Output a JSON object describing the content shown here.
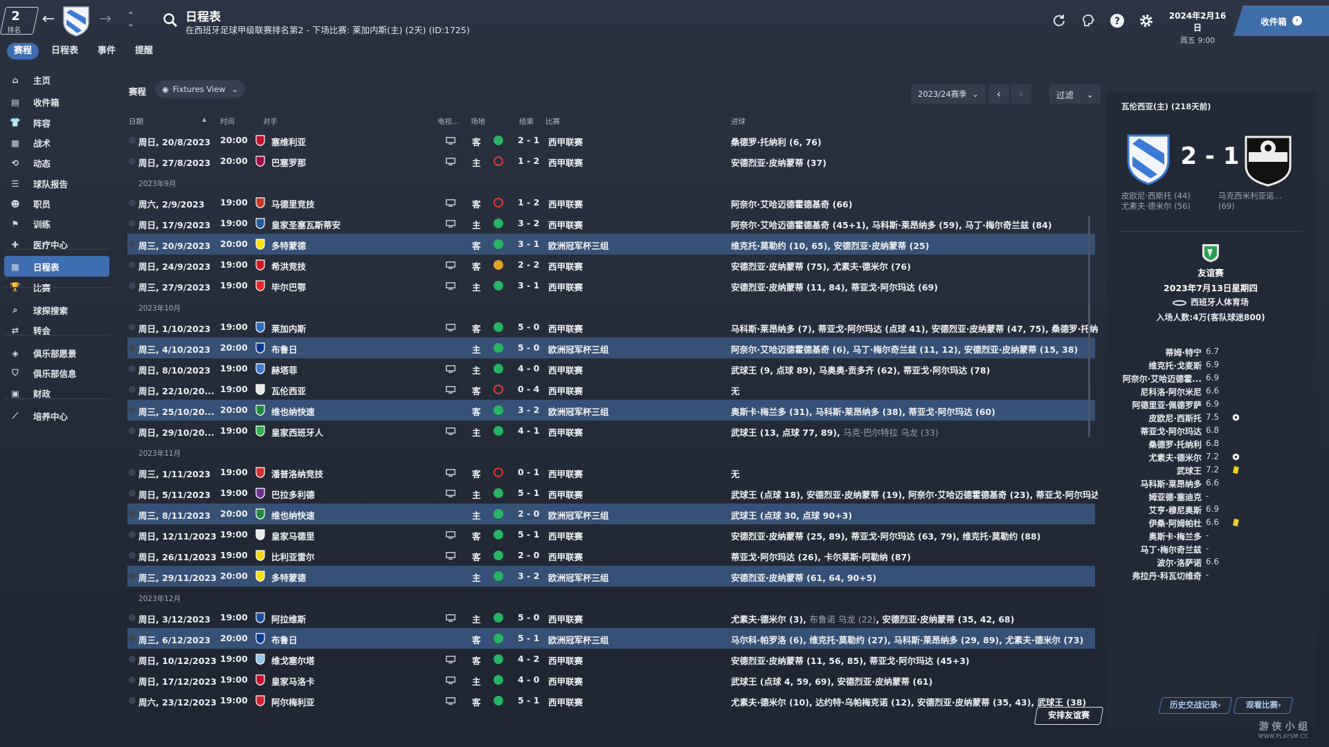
{
  "topbar": {
    "rank_number": "2",
    "rank_label": "排名",
    "title": "日程表",
    "subtitle": "在西班牙足球甲级联赛排名第2 - 下场比赛: 莱加内斯(主) (2天) (ID:1725)",
    "date": "2024年2月16日",
    "weekday_time": "周五 9:00",
    "inbox_label": "收件箱",
    "accent": "#3e6db0"
  },
  "subnav": {
    "tabs": [
      "赛程",
      "日程表",
      "事件",
      "提醒"
    ],
    "active": "赛程"
  },
  "sidebar": {
    "items": [
      {
        "label": "主页",
        "icon": "home-icon"
      },
      {
        "label": "收件箱",
        "icon": "inbox-icon"
      },
      {
        "label": "阵容",
        "icon": "squad-icon"
      },
      {
        "label": "战术",
        "icon": "tactics-icon"
      },
      {
        "label": "动态",
        "icon": "dynamics-icon"
      },
      {
        "label": "球队报告",
        "icon": "report-icon"
      },
      {
        "label": "职员",
        "icon": "staff-icon"
      },
      {
        "label": "训练",
        "icon": "training-icon"
      },
      {
        "label": "医疗中心",
        "icon": "medical-icon"
      },
      {
        "label": "日程表",
        "icon": "calendar-icon"
      },
      {
        "label": "比赛",
        "icon": "trophy-icon"
      },
      {
        "label": "球探搜索",
        "icon": "search-icon"
      },
      {
        "label": "转会",
        "icon": "transfer-icon"
      },
      {
        "label": "俱乐部愿景",
        "icon": "vision-icon"
      },
      {
        "label": "俱乐部信息",
        "icon": "club-info-icon"
      },
      {
        "label": "财政",
        "icon": "finance-icon"
      },
      {
        "label": "培养中心",
        "icon": "development-icon"
      }
    ],
    "active": "日程表"
  },
  "main": {
    "label": "赛程",
    "view_dropdown": "Fixtures View",
    "season": "2023/24赛季",
    "filter": "过滤",
    "headers": {
      "date": "日期",
      "time": "时间",
      "opponent": "对手",
      "tv": "电视...",
      "venue": "场地",
      "result": "结果",
      "competition": "比赛",
      "scorers": "进球"
    },
    "friendly_button": "安排友谊赛",
    "rows": [
      {
        "type": "match",
        "date": "周日, 20/8/2023",
        "time": "20:00",
        "opp": "塞维利亚",
        "tv": true,
        "venue": "客",
        "res": "w",
        "score": "2 - 1",
        "comp": "西甲联赛",
        "scorers": "桑德罗·托纳利 (6, 76)",
        "dim": "",
        "cl": false,
        "badge": "#c8102e"
      },
      {
        "type": "match",
        "date": "周日, 27/8/2023",
        "time": "20:00",
        "opp": "巴塞罗那",
        "tv": true,
        "venue": "主",
        "res": "l",
        "score": "1 - 2",
        "comp": "西甲联赛",
        "scorers": "安德烈亚·皮纳蒙蒂 (37)",
        "dim": "",
        "cl": false,
        "badge": "#a50044"
      },
      {
        "type": "month",
        "label": "2023年9月"
      },
      {
        "type": "match",
        "date": "周六, 2/9/2023",
        "time": "19:00",
        "opp": "马德里竞技",
        "tv": true,
        "venue": "客",
        "res": "l",
        "score": "1 - 2",
        "comp": "西甲联赛",
        "scorers": "阿奈尔·艾哈迈德霍德基奇 (66)",
        "dim": "",
        "cl": false,
        "badge": "#cb3524"
      },
      {
        "type": "match",
        "date": "周日, 17/9/2023",
        "time": "19:00",
        "opp": "皇家圣塞瓦斯蒂安",
        "tv": true,
        "venue": "主",
        "res": "w",
        "score": "3 - 2",
        "comp": "西甲联赛",
        "scorers": "阿奈尔·艾哈迈德霍德基奇 (45+1), 马科斯·莱昂纳多 (59), 马丁·梅尔奇兰兹 (84)",
        "dim": "",
        "cl": false,
        "badge": "#1d5fa6"
      },
      {
        "type": "match",
        "date": "周三, 20/9/2023",
        "time": "20:00",
        "opp": "多特蒙德",
        "tv": false,
        "venue": "客",
        "res": "w",
        "score": "3 - 1",
        "comp": "欧洲冠军杯三组",
        "scorers": "维克托·莫勒约 (10, 65), 安德烈亚·皮纳蒙蒂 (25)",
        "dim": "",
        "cl": true,
        "badge": "#fde100"
      },
      {
        "type": "match",
        "date": "周日, 24/9/2023",
        "time": "19:00",
        "opp": "希洪竞技",
        "tv": true,
        "venue": "客",
        "res": "d",
        "score": "2 - 2",
        "comp": "西甲联赛",
        "scorers": "安德烈亚·皮纳蒙蒂 (75), 尤素夫·德米尔 (76)",
        "dim": "",
        "cl": false,
        "badge": "#d71920"
      },
      {
        "type": "match",
        "date": "周三, 27/9/2023",
        "time": "19:00",
        "opp": "毕尔巴鄂",
        "tv": true,
        "venue": "主",
        "res": "w",
        "score": "3 - 1",
        "comp": "西甲联赛",
        "scorers": "安德烈亚·皮纳蒙蒂 (11, 84), 蒂亚戈·阿尔玛达 (69)",
        "dim": "",
        "cl": false,
        "badge": "#ee2523"
      },
      {
        "type": "month",
        "label": "2023年10月"
      },
      {
        "type": "match",
        "date": "周日, 1/10/2023",
        "time": "19:00",
        "opp": "莱加内斯",
        "tv": true,
        "venue": "客",
        "res": "w",
        "score": "5 - 0",
        "comp": "西甲联赛",
        "scorers": "马科斯·莱昂纳多 (7), 蒂亚戈·阿尔玛达 (点球 41), 安德烈亚·皮纳蒙蒂 (47, 75), 桑德罗·托纳利 (...",
        "dim": "",
        "cl": false,
        "badge": "#2a6fc0"
      },
      {
        "type": "match",
        "date": "周三, 4/10/2023",
        "time": "20:00",
        "opp": "布鲁日",
        "tv": false,
        "venue": "主",
        "res": "w",
        "score": "5 - 0",
        "comp": "欧洲冠军杯三组",
        "scorers": "阿奈尔·艾哈迈德霍德基奇 (6), 马丁·梅尔奇兰兹 (11, 12), 安德烈亚·皮纳蒙蒂 (15, 38)",
        "dim": "",
        "cl": true,
        "badge": "#0a3d91"
      },
      {
        "type": "match",
        "date": "周日, 8/10/2023",
        "time": "19:00",
        "opp": "赫塔菲",
        "tv": true,
        "venue": "主",
        "res": "w",
        "score": "4 - 0",
        "comp": "西甲联赛",
        "scorers": "武球王 (9, 点球 89), 马奥奥·贡多齐 (62), 蒂亚戈·阿尔玛达 (78)",
        "dim": "",
        "cl": false,
        "badge": "#3a7bd5"
      },
      {
        "type": "match",
        "date": "周日, 22/10/20...",
        "time": "19:00",
        "opp": "瓦伦西亚",
        "tv": true,
        "venue": "客",
        "res": "l",
        "score": "0 - 4",
        "comp": "西甲联赛",
        "scorers": "无",
        "dim": "",
        "cl": false,
        "badge": "#e8e8e8"
      },
      {
        "type": "match",
        "date": "周三, 25/10/20...",
        "time": "20:00",
        "opp": "维也纳快速",
        "tv": false,
        "venue": "客",
        "res": "w",
        "score": "3 - 2",
        "comp": "欧洲冠军杯三组",
        "scorers": "奥斯卡·梅兰多 (31), 马科斯·莱昂纳多 (38), 蒂亚戈·阿尔玛达 (60)",
        "dim": "",
        "cl": true,
        "badge": "#1e8a3c"
      },
      {
        "type": "match",
        "date": "周日, 29/10/20...",
        "time": "19:00",
        "opp": "皇家西班牙人",
        "tv": true,
        "venue": "主",
        "res": "w",
        "score": "4 - 1",
        "comp": "西甲联赛",
        "scorers": "武球王 (13, 点球 77, 89), ",
        "dim": "马克·巴尔特拉 乌龙 (33)",
        "cl": false,
        "badge": "#2fb24a"
      },
      {
        "type": "month",
        "label": "2023年11月"
      },
      {
        "type": "match",
        "date": "周三, 1/11/2023",
        "time": "19:00",
        "opp": "潘普洛纳竞技",
        "tv": true,
        "venue": "客",
        "res": "l",
        "score": "0 - 1",
        "comp": "西甲联赛",
        "scorers": "无",
        "dim": "",
        "cl": false,
        "badge": "#d62e2e"
      },
      {
        "type": "match",
        "date": "周日, 5/11/2023",
        "time": "19:00",
        "opp": "巴拉多利德",
        "tv": true,
        "venue": "主",
        "res": "w",
        "score": "5 - 1",
        "comp": "西甲联赛",
        "scorers": "武球王 (点球 18), 安德烈亚·皮纳蒙蒂 (19), 阿奈尔·艾哈迈德霍德基奇 (23), 蒂亚戈·阿尔玛达 (...",
        "dim": "",
        "cl": false,
        "badge": "#6c2c91"
      },
      {
        "type": "match",
        "date": "周三, 8/11/2023",
        "time": "20:00",
        "opp": "维也纳快速",
        "tv": false,
        "venue": "主",
        "res": "w",
        "score": "2 - 0",
        "comp": "欧洲冠军杯三组",
        "scorers": "武球王 (点球 30, 点球 90+3)",
        "dim": "",
        "cl": true,
        "badge": "#1e8a3c"
      },
      {
        "type": "match",
        "date": "周日, 12/11/2023",
        "time": "19:00",
        "opp": "皇家马德里",
        "tv": true,
        "venue": "客",
        "res": "w",
        "score": "5 - 1",
        "comp": "西甲联赛",
        "scorers": "安德烈亚·皮纳蒙蒂 (25, 89), 蒂亚戈·阿尔玛达 (63, 79), 维克托·莫勒约 (88)",
        "dim": "",
        "cl": false,
        "badge": "#e8e8e8"
      },
      {
        "type": "match",
        "date": "周日, 26/11/2023",
        "time": "19:00",
        "opp": "比利亚雷尔",
        "tv": true,
        "venue": "客",
        "res": "w",
        "score": "2 - 0",
        "comp": "西甲联赛",
        "scorers": "蒂亚戈·阿尔玛达 (26), 卡尔莱斯·阿勒纳 (87)",
        "dim": "",
        "cl": false,
        "badge": "#f5d90a"
      },
      {
        "type": "match",
        "date": "周三, 29/11/2023",
        "time": "20:00",
        "opp": "多特蒙德",
        "tv": false,
        "venue": "主",
        "res": "w",
        "score": "3 - 2",
        "comp": "欧洲冠军杯三组",
        "scorers": "安德烈亚·皮纳蒙蒂 (61, 64, 90+5)",
        "dim": "",
        "cl": true,
        "badge": "#fde100"
      },
      {
        "type": "month",
        "label": "2023年12月"
      },
      {
        "type": "match",
        "date": "周日, 3/12/2023",
        "time": "19:00",
        "opp": "阿拉维斯",
        "tv": true,
        "venue": "主",
        "res": "w",
        "score": "5 - 0",
        "comp": "西甲联赛",
        "scorers": "尤素夫·德米尔 (3), ",
        "dim": "布鲁诺 乌龙 (22)",
        "scorers2": ", 安德烈亚·皮纳蒙蒂 (35, 42, 68)",
        "cl": false,
        "badge": "#1e4ea3"
      },
      {
        "type": "match",
        "date": "周三, 6/12/2023",
        "time": "20:00",
        "opp": "布鲁日",
        "tv": false,
        "venue": "客",
        "res": "w",
        "score": "5 - 1",
        "comp": "欧洲冠军杯三组",
        "scorers": "马尔科·帕罗洛 (6), 维克托·莫勒约 (27), 马科斯·莱昂纳多 (29, 89), 尤素夫·德米尔 (73)",
        "dim": "",
        "cl": true,
        "badge": "#0a3d91"
      },
      {
        "type": "match",
        "date": "周日, 10/12/2023",
        "time": "19:00",
        "opp": "维戈塞尔塔",
        "tv": true,
        "venue": "客",
        "res": "w",
        "score": "4 - 2",
        "comp": "西甲联赛",
        "scorers": "安德烈亚·皮纳蒙蒂 (11, 56, 85), 蒂亚戈·阿尔玛达 (45+3)",
        "dim": "",
        "cl": false,
        "badge": "#8cc4ec"
      },
      {
        "type": "match",
        "date": "周日, 17/12/2023",
        "time": "19:00",
        "opp": "皇家马洛卡",
        "tv": true,
        "venue": "主",
        "res": "w",
        "score": "4 - 0",
        "comp": "西甲联赛",
        "scorers": "武球王 (点球 4, 59, 69), 安德烈亚·皮纳蒙蒂 (61)",
        "dim": "",
        "cl": false,
        "badge": "#c8102e"
      },
      {
        "type": "match",
        "date": "周六, 23/12/2023",
        "time": "19:00",
        "opp": "阿尔梅利亚",
        "tv": true,
        "venue": "客",
        "res": "w",
        "score": "5 - 1",
        "comp": "西甲联赛",
        "scorers": "尤素夫·德米尔 (10), 达约特·乌帕梅克诺 (12), 安德烈亚·皮纳蒙蒂 (35, 43), 武球王 (38)",
        "dim": "",
        "cl": false,
        "badge": "#d81e2e"
      }
    ]
  },
  "match_panel": {
    "header": "瓦伦西亚(主) (218天前)",
    "score": "2 - 1",
    "home_scorers": [
      "皮欧尼·西斯托 (44)",
      "尤素夫·德米尔 (56)"
    ],
    "away_scorers": [
      "马克西米利亚诺...",
      "(69)"
    ],
    "competition": "友谊赛",
    "date": "2023年7月13日星期四",
    "stadium": "西班牙人体育场",
    "attendance": "入场人数:4万(客队球迷800)",
    "players": [
      {
        "name": "蒂姆·特宁",
        "rating": "6.7",
        "mark": ""
      },
      {
        "name": "维克托·戈麦斯",
        "rating": "6.9",
        "mark": ""
      },
      {
        "name": "阿奈尔·艾哈迈德霍...",
        "rating": "6.9",
        "mark": ""
      },
      {
        "name": "尼科洛·阿尔米尼",
        "rating": "6.6",
        "mark": ""
      },
      {
        "name": "阿德里亚·佩德罗萨",
        "rating": "6.9",
        "mark": ""
      },
      {
        "name": "皮欧尼·西斯托",
        "rating": "7.5",
        "mark": "ball-icon"
      },
      {
        "name": "蒂亚戈·阿尔玛达",
        "rating": "6.8",
        "mark": ""
      },
      {
        "name": "桑德罗·托纳利",
        "rating": "6.8",
        "mark": ""
      },
      {
        "name": "尤素夫·德米尔",
        "rating": "7.2",
        "mark": "ball-icon"
      },
      {
        "name": "武球王",
        "rating": "7.2",
        "mark": "yellow-card-icon"
      },
      {
        "name": "马科斯·莱昂纳多",
        "rating": "6.6",
        "mark": ""
      },
      {
        "name": "姆亚德·塞迪克",
        "rating": "-",
        "mark": ""
      },
      {
        "name": "艾亨·穆尼奥斯",
        "rating": "6.9",
        "mark": ""
      },
      {
        "name": "伊桑·阿姆帕杜",
        "rating": "6.6",
        "mark": "yellow-card-icon"
      },
      {
        "name": "奥斯卡·梅兰多",
        "rating": "-",
        "mark": ""
      },
      {
        "name": "马丁·梅尔奇兰兹",
        "rating": "-",
        "mark": ""
      },
      {
        "name": "波尔·洛萨诺",
        "rating": "6.6",
        "mark": ""
      },
      {
        "name": "弗拉丹·科瓦切维奇",
        "rating": "-",
        "mark": ""
      }
    ],
    "h2h_button": "历史交战记录",
    "watch_button": "观看比赛"
  },
  "watermark": {
    "line1": "游 侠 小 组",
    "line2": "WWW.PLAYSM.CC"
  }
}
